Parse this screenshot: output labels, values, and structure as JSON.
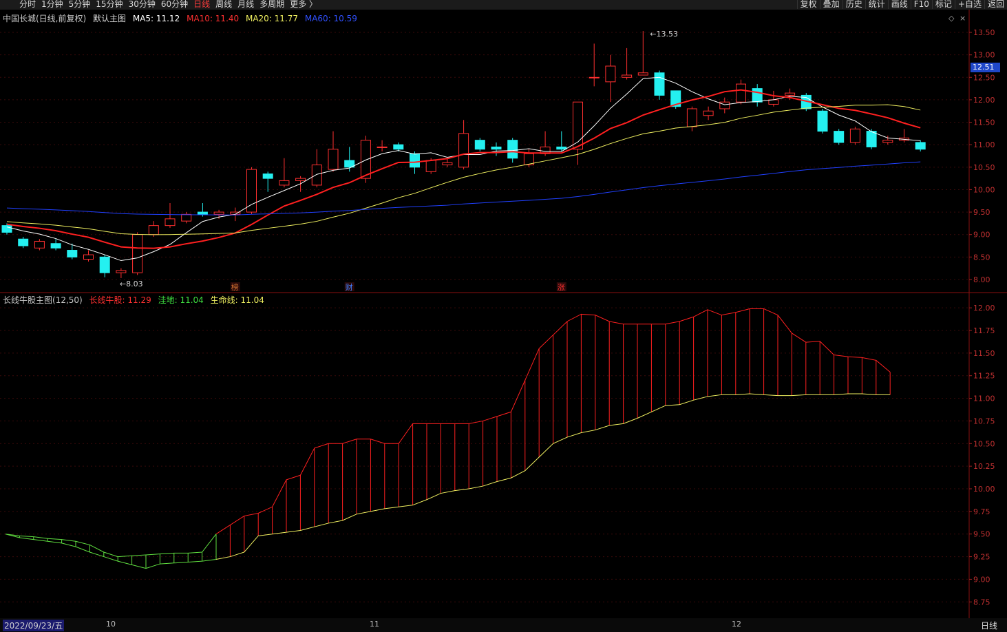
{
  "toolbar": {
    "left": [
      "分时",
      "1分钟",
      "5分钟",
      "15分钟",
      "30分钟",
      "60分钟",
      "日线",
      "周线",
      "月线",
      "多周期",
      "更多 〉"
    ],
    "active": "日线",
    "right": [
      "复权",
      "叠加",
      "历史",
      "统计",
      "画线",
      "F10",
      "标记",
      "+自选",
      "返回"
    ]
  },
  "main_info": {
    "stock": "中国长城(日线,前复权)",
    "indicator": "默认主图",
    "ma5": "MA5: 11.12",
    "ma10": "MA10: 11.40",
    "ma20": "MA20: 11.77",
    "ma60": "MA60: 10.59"
  },
  "sub_info": {
    "indicator": "长线牛股主图(12,50)",
    "v1": "长线牛股: 11.29",
    "v2": "洼地: 11.04",
    "v3": "生命线: 11.04"
  },
  "current_price": "12.51",
  "markers": {
    "high": "13.53",
    "low": "8.03",
    "tags": [
      "榜",
      "财",
      "涨"
    ]
  },
  "bottom": {
    "date": "2022/09/23/五",
    "period": "日线",
    "months": [
      "10",
      "11",
      "12"
    ]
  },
  "colors": {
    "up": "#ff3030",
    "down": "#24f0f0",
    "ma5": "#ffffff",
    "ma10": "#ff2020",
    "ma20": "#f0f060",
    "ma60": "#2040ff"
  },
  "chart_data": [
    {
      "type": "candlestick",
      "title": "中国长城(日线,前复权)",
      "ylim": [
        7.8,
        13.7
      ],
      "yticks": [
        "13.50",
        "13.00",
        "12.50",
        "12.00",
        "11.50",
        "11.00",
        "10.50",
        "10.00",
        "9.50",
        "9.00",
        "8.50",
        "8.00"
      ],
      "candles": [
        [
          9.2,
          9.05,
          9.25,
          9.0
        ],
        [
          8.9,
          8.75,
          8.95,
          8.7
        ],
        [
          8.7,
          8.85,
          8.9,
          8.65
        ],
        [
          8.8,
          8.7,
          8.9,
          8.65
        ],
        [
          8.65,
          8.5,
          8.8,
          8.45
        ],
        [
          8.45,
          8.55,
          8.65,
          8.4
        ],
        [
          8.5,
          8.15,
          8.55,
          8.05
        ],
        [
          8.15,
          8.2,
          8.25,
          8.03
        ],
        [
          8.15,
          9.0,
          9.05,
          8.1
        ],
        [
          9.0,
          9.2,
          9.3,
          8.95
        ],
        [
          9.2,
          9.35,
          9.7,
          9.15
        ],
        [
          9.3,
          9.45,
          9.5,
          9.25
        ],
        [
          9.5,
          9.45,
          9.7,
          9.4
        ],
        [
          9.45,
          9.5,
          9.55,
          9.35
        ],
        [
          9.45,
          9.5,
          9.6,
          9.3
        ],
        [
          9.5,
          10.45,
          10.5,
          9.45
        ],
        [
          10.35,
          10.25,
          10.4,
          9.95
        ],
        [
          10.1,
          10.2,
          10.7,
          10.05
        ],
        [
          10.2,
          10.25,
          10.3,
          9.95
        ],
        [
          10.1,
          10.55,
          10.9,
          10.05
        ],
        [
          10.45,
          10.9,
          11.3,
          10.4
        ],
        [
          10.65,
          10.5,
          10.95,
          10.4
        ],
        [
          10.25,
          11.1,
          11.2,
          10.15
        ],
        [
          10.95,
          10.95,
          11.1,
          10.85
        ],
        [
          11.0,
          10.9,
          11.05,
          10.85
        ],
        [
          10.8,
          10.5,
          10.85,
          10.35
        ],
        [
          10.4,
          10.65,
          10.7,
          10.35
        ],
        [
          10.55,
          10.6,
          10.7,
          10.5
        ],
        [
          10.5,
          11.25,
          11.55,
          10.45
        ],
        [
          11.1,
          10.9,
          11.15,
          10.85
        ],
        [
          10.95,
          10.9,
          11.05,
          10.75
        ],
        [
          11.1,
          10.7,
          11.15,
          10.6
        ],
        [
          10.55,
          10.8,
          10.9,
          10.5
        ],
        [
          10.8,
          10.95,
          11.3,
          10.75
        ],
        [
          10.95,
          10.9,
          11.3,
          10.85
        ],
        [
          10.9,
          11.95,
          11.95,
          10.55
        ],
        [
          12.5,
          12.5,
          13.25,
          12.3
        ],
        [
          12.4,
          12.75,
          13.0,
          11.95
        ],
        [
          12.5,
          12.55,
          13.15,
          12.45
        ],
        [
          12.55,
          12.6,
          13.53,
          12.55
        ],
        [
          12.6,
          12.1,
          12.65,
          12.0
        ],
        [
          12.2,
          11.85,
          12.2,
          11.8
        ],
        [
          11.4,
          11.8,
          11.85,
          11.3
        ],
        [
          11.65,
          11.75,
          11.85,
          11.55
        ],
        [
          11.8,
          11.95,
          12.05,
          11.7
        ],
        [
          11.95,
          12.35,
          12.45,
          11.9
        ],
        [
          12.25,
          11.95,
          12.35,
          11.85
        ],
        [
          11.9,
          12.0,
          12.2,
          11.85
        ],
        [
          12.1,
          12.15,
          12.25,
          12.0
        ],
        [
          12.1,
          11.8,
          12.15,
          11.75
        ],
        [
          11.75,
          11.3,
          11.8,
          11.25
        ],
        [
          11.3,
          11.05,
          11.35,
          11.0
        ],
        [
          11.05,
          11.35,
          11.4,
          11.0
        ],
        [
          11.3,
          10.95,
          11.35,
          10.9
        ],
        [
          11.05,
          11.1,
          11.2,
          11.0
        ],
        [
          11.1,
          11.15,
          11.35,
          11.05
        ],
        [
          11.05,
          10.9,
          11.1,
          10.85
        ]
      ]
    },
    {
      "type": "area",
      "title": "长线牛股主图(12,50)",
      "ylim": [
        8.6,
        12.1
      ],
      "yticks": [
        "12.00",
        "11.75",
        "11.50",
        "11.25",
        "11.00",
        "10.75",
        "10.50",
        "10.25",
        "10.00",
        "9.75",
        "9.50",
        "9.25",
        "9.00",
        "8.75"
      ],
      "series": [
        {
          "name": "长线牛股",
          "values": [
            9.5,
            9.48,
            9.47,
            9.45,
            9.44,
            9.42,
            9.38,
            9.3,
            9.25,
            9.26,
            9.27,
            9.28,
            9.29,
            9.29,
            9.3,
            9.5,
            9.6,
            9.7,
            9.73,
            9.8,
            10.1,
            10.15,
            10.45,
            10.5,
            10.5,
            10.55,
            10.55,
            10.5,
            10.5,
            10.72,
            10.72,
            10.72,
            10.72,
            10.72,
            10.75,
            10.8,
            10.85,
            11.2,
            11.55,
            11.7,
            11.85,
            11.93,
            11.92,
            11.85,
            11.82,
            11.82,
            11.82,
            11.82,
            11.85,
            11.9,
            11.98,
            11.92,
            11.95,
            11.99,
            11.99,
            11.92,
            11.72,
            11.62,
            11.63,
            11.48,
            11.46,
            11.45,
            11.42,
            11.29
          ]
        },
        {
          "name": "生命线",
          "values": [
            9.5,
            9.46,
            9.44,
            9.42,
            9.4,
            9.36,
            9.3,
            9.25,
            9.2,
            9.16,
            9.12,
            9.17,
            9.18,
            9.19,
            9.2,
            9.22,
            9.25,
            9.3,
            9.48,
            9.5,
            9.52,
            9.54,
            9.58,
            9.62,
            9.65,
            9.72,
            9.75,
            9.78,
            9.8,
            9.82,
            9.88,
            9.95,
            9.98,
            10.0,
            10.03,
            10.08,
            10.12,
            10.2,
            10.35,
            10.5,
            10.57,
            10.62,
            10.65,
            10.7,
            10.72,
            10.78,
            10.85,
            10.92,
            10.93,
            10.98,
            11.02,
            11.04,
            11.04,
            11.05,
            11.04,
            11.03,
            11.03,
            11.04,
            11.04,
            11.04,
            11.05,
            11.05,
            11.04,
            11.04
          ]
        }
      ]
    }
  ]
}
